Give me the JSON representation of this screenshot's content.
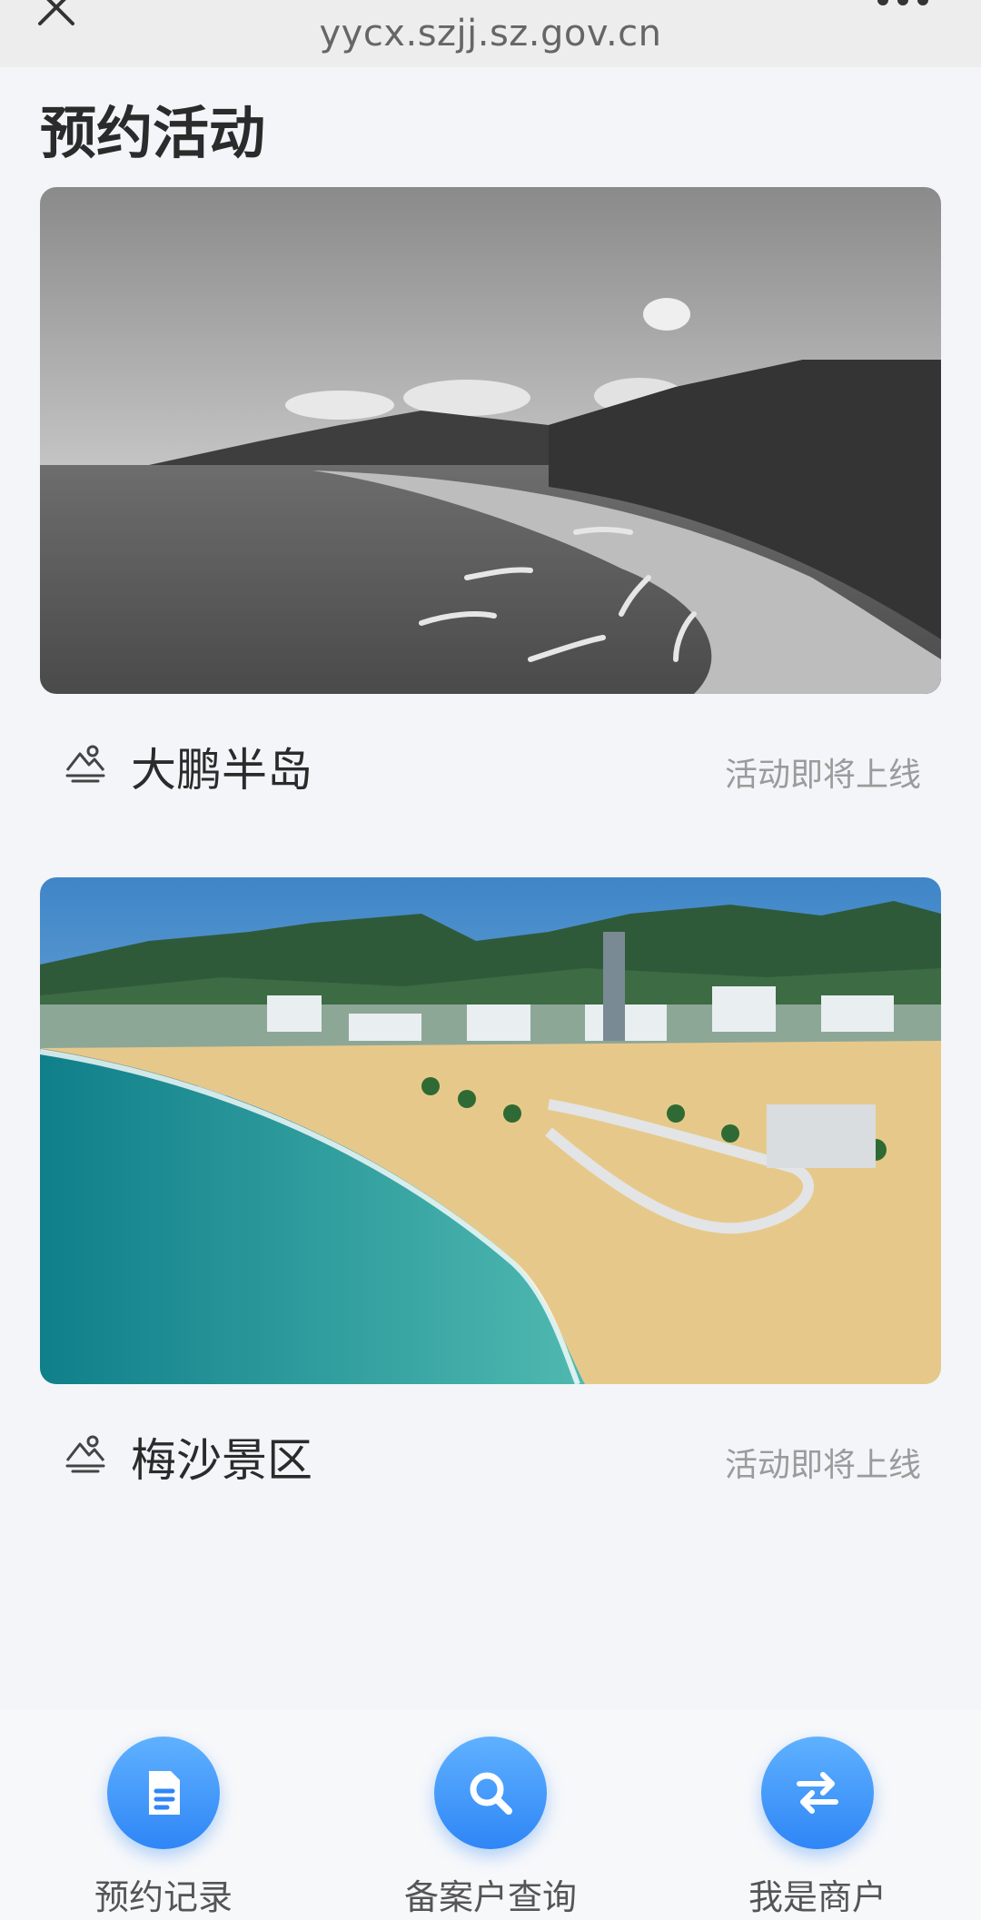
{
  "browser": {
    "url": "yycx.szjj.sz.gov.cn",
    "close_icon": "close-icon",
    "more_icon": "more-icon"
  },
  "page": {
    "title": "预约活动"
  },
  "activities": [
    {
      "name": "大鹏半岛",
      "status": "活动即将上线",
      "icon": "scenery-icon",
      "image": "grayscale coastline bay photo"
    },
    {
      "name": "梅沙景区",
      "status": "活动即将上线",
      "icon": "scenery-icon",
      "image": "colour beach boardwalk photo"
    }
  ],
  "bottom_nav": [
    {
      "label": "预约记录",
      "icon": "document-icon"
    },
    {
      "label": "备案户查询",
      "icon": "search-icon"
    },
    {
      "label": "我是商户",
      "icon": "swap-icon"
    }
  ],
  "colors": {
    "accent": "#2f86f6",
    "background": "#f3f5f8",
    "status_text": "#9b9b9b"
  }
}
